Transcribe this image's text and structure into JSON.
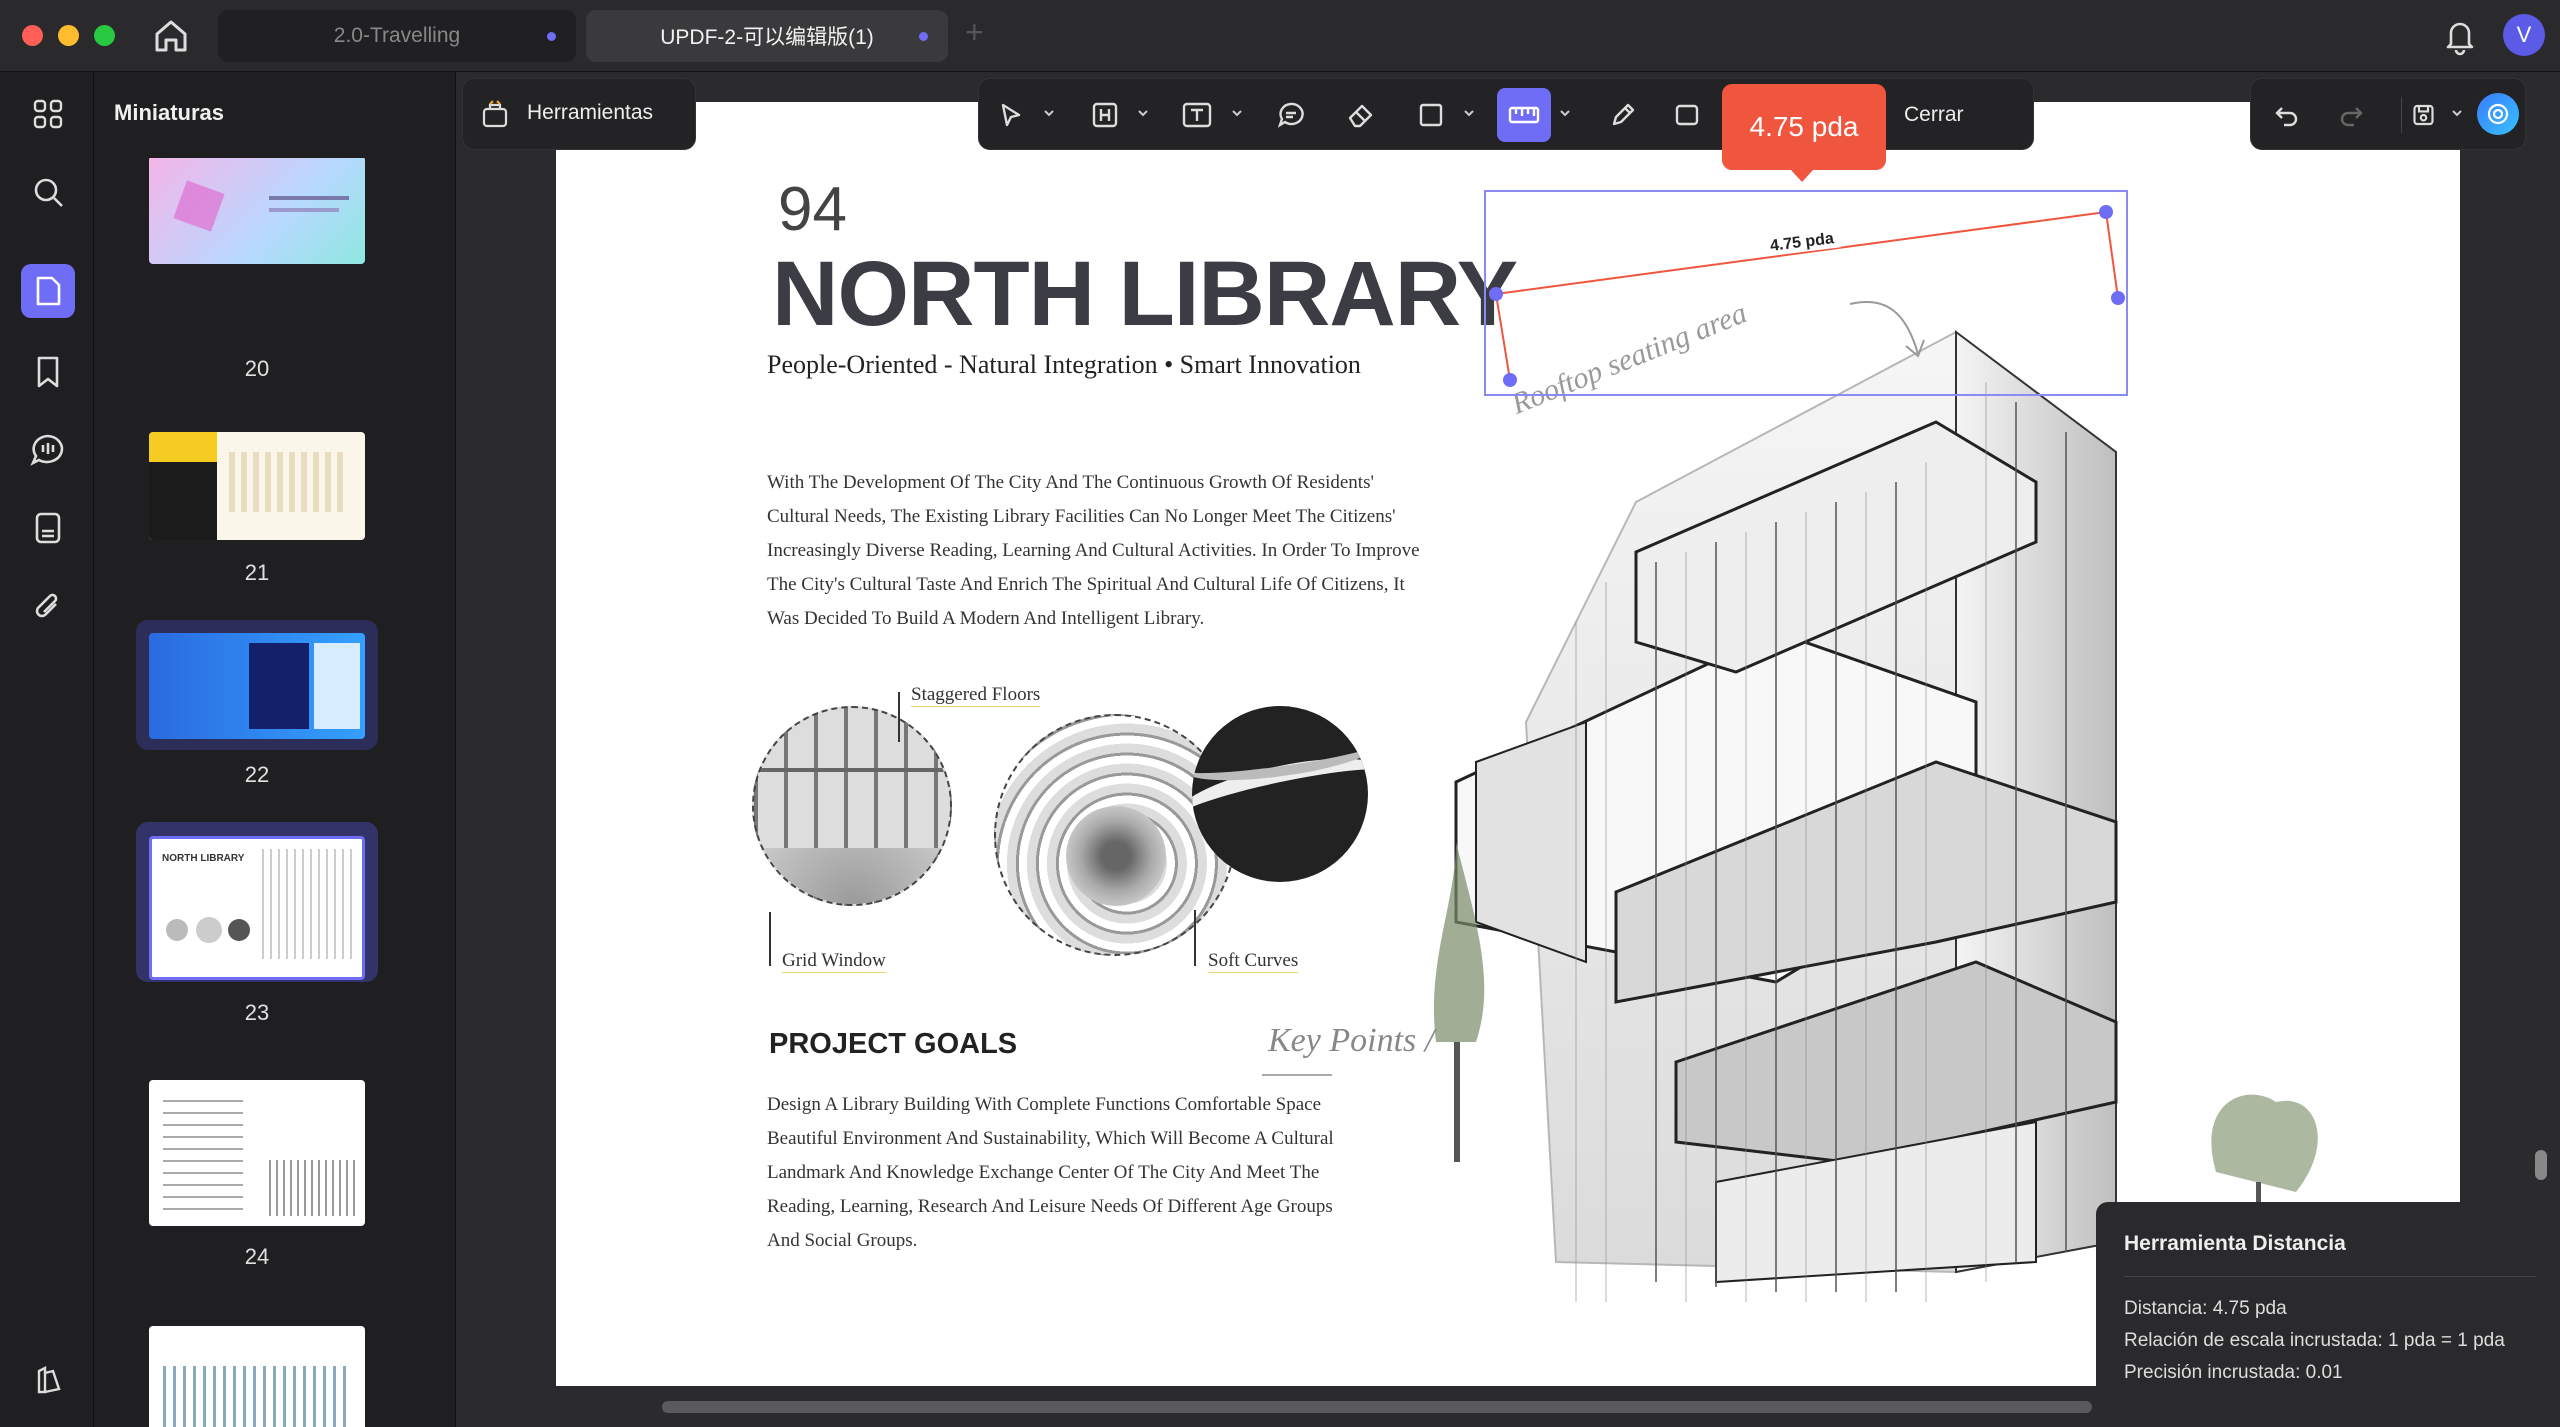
{
  "window": {
    "tabs": [
      {
        "label": "2.0-Travelling"
      },
      {
        "label": "UPDF-2-可以编辑版(1)"
      }
    ],
    "user_initial": "V"
  },
  "sidebar": {
    "title": "Miniaturas",
    "icons": [
      "thumbnails-grid-icon",
      "search-icon",
      "pages-icon",
      "bookmark-icon",
      "comments-icon",
      "organize-icon",
      "attachment-icon",
      "theme-icon"
    ]
  },
  "thumbnails": [
    {
      "page": "20"
    },
    {
      "page": "21"
    },
    {
      "page": "22"
    },
    {
      "page": "23"
    },
    {
      "page": "24"
    },
    {
      "page": ""
    }
  ],
  "toolbar": {
    "tools_label": "Herramientas",
    "close_label": "Cerrar"
  },
  "measurement": {
    "pill": "4.75 pda",
    "line_label": "4.75 pda"
  },
  "document": {
    "page_num": "94",
    "title": "NORTH LIBRARY",
    "subtitle": "People-Oriented - Natural Integration • Smart Innovation",
    "intro": [
      "With The Development Of The City And The Continuous Growth Of Residents'",
      "Cultural Needs, The Existing Library Facilities Can No Longer Meet The Citizens'",
      "Increasingly Diverse Reading, Learning And Cultural Activities. In Order To Improve",
      "The City's Cultural Taste And Enrich The Spiritual And Cultural Life Of Citizens, It",
      "Was Decided To Build A Modern And Intelligent Library."
    ],
    "label_staggered": "Staggered Floors",
    "label_grid": "Grid Window",
    "label_soft": "Soft Curves",
    "rooftop": "Rooftop seating area",
    "goals_title": "PROJECT GOALS",
    "key_points": "Key Points /",
    "goals": [
      "Design A Library Building With Complete Functions Comfortable Space",
      "Beautiful Environment And Sustainability, Which Will Become A Cultural",
      "Landmark And Knowledge Exchange Center Of The City And Meet The",
      "Reading, Learning, Research And Leisure Needs Of Different Age Groups",
      "And Social Groups."
    ]
  },
  "info_panel": {
    "title": "Herramienta Distancia",
    "distance": "Distancia: 4.75 pda",
    "scale": "Relación de escala incrustada: 1 pda = 1 pda",
    "precision": "Precisión incrustada: 0.01"
  },
  "colors": {
    "accent": "#6f6cf5",
    "measure": "#f0553e"
  }
}
